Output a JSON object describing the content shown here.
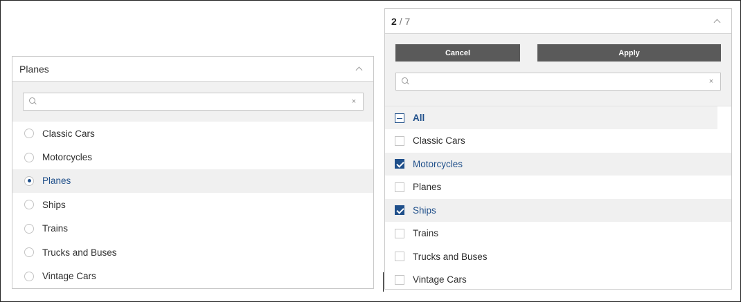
{
  "single_select": {
    "header_title": "Planes",
    "search": {
      "value": "",
      "placeholder": ""
    },
    "options": [
      {
        "label": "Classic Cars",
        "selected": false
      },
      {
        "label": "Motorcycles",
        "selected": false
      },
      {
        "label": "Planes",
        "selected": true
      },
      {
        "label": "Ships",
        "selected": false
      },
      {
        "label": "Trains",
        "selected": false
      },
      {
        "label": "Trucks and Buses",
        "selected": false
      },
      {
        "label": "Vintage Cars",
        "selected": false
      }
    ]
  },
  "multi_select": {
    "selected_count": "2",
    "count_separator": "/",
    "total_count": "7",
    "cancel_label": "Cancel",
    "apply_label": "Apply",
    "search": {
      "value": "",
      "placeholder": ""
    },
    "all_label": "All",
    "options": [
      {
        "label": "Classic Cars",
        "checked": false
      },
      {
        "label": "Motorcycles",
        "checked": true
      },
      {
        "label": "Planes",
        "checked": false
      },
      {
        "label": "Ships",
        "checked": true
      },
      {
        "label": "Trains",
        "checked": false
      },
      {
        "label": "Trucks and Buses",
        "checked": false
      },
      {
        "label": "Vintage Cars",
        "checked": false
      }
    ]
  },
  "icons": {
    "search": "search-icon",
    "clear": "close-icon",
    "collapse": "chevron-up-icon",
    "clear_glyph": "×"
  },
  "colors": {
    "accent": "#1f4f8a",
    "button_bg": "#5a5a5a",
    "panel_bg": "#f1f1f1"
  }
}
